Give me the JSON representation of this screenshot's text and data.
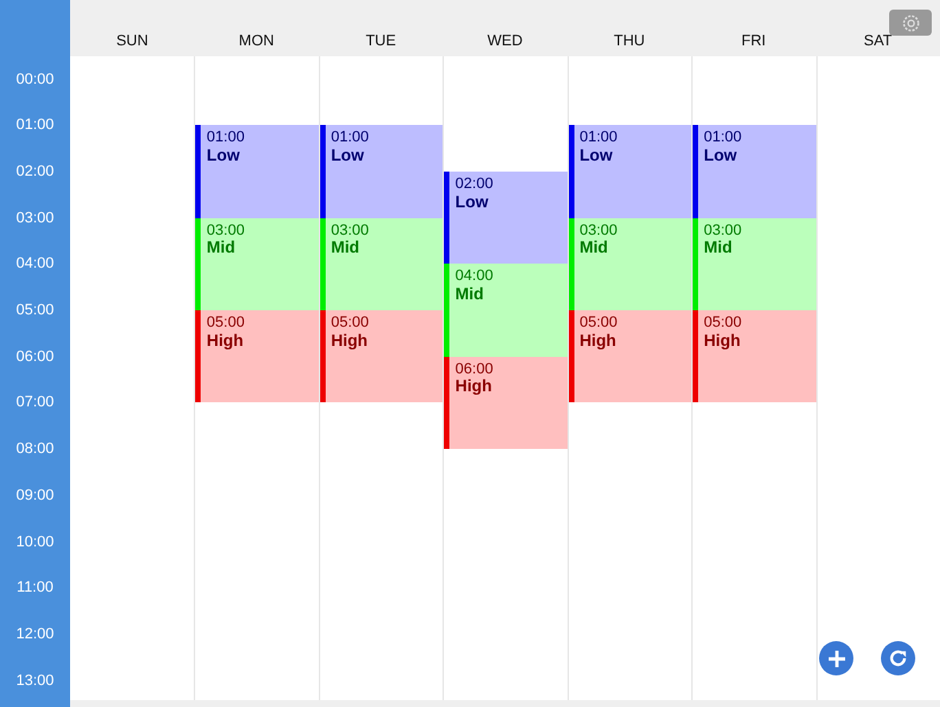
{
  "hours": [
    "00:00",
    "01:00",
    "02:00",
    "03:00",
    "04:00",
    "05:00",
    "06:00",
    "07:00",
    "08:00",
    "09:00",
    "10:00",
    "11:00",
    "12:00",
    "13:00"
  ],
  "days": [
    {
      "label": "SUN"
    },
    {
      "label": "MON",
      "events": [
        {
          "time": "01:00",
          "label": "Low",
          "kind": "low",
          "color": "#0000ee"
        },
        {
          "time": "03:00",
          "label": "Mid",
          "kind": "mid",
          "color": "#00ee00"
        },
        {
          "time": "05:00",
          "label": "High",
          "kind": "high",
          "color": "#ee0000"
        }
      ]
    },
    {
      "label": "TUE",
      "events": [
        {
          "time": "01:00",
          "label": "Low",
          "kind": "low",
          "color": "#0000ee"
        },
        {
          "time": "03:00",
          "label": "Mid",
          "kind": "mid",
          "color": "#00ee00"
        },
        {
          "time": "05:00",
          "label": "High",
          "kind": "high",
          "color": "#ee0000"
        }
      ]
    },
    {
      "label": "WED",
      "events": [
        {
          "time": "02:00",
          "label": "Low",
          "kind": "low",
          "color": "#0000ee"
        },
        {
          "time": "04:00",
          "label": "Mid",
          "kind": "mid",
          "color": "#00ee00"
        },
        {
          "time": "06:00",
          "label": "High",
          "kind": "high",
          "color": "#ee0000"
        }
      ]
    },
    {
      "label": "THU",
      "events": [
        {
          "time": "01:00",
          "label": "Low",
          "kind": "low",
          "color": "#0000ee"
        },
        {
          "time": "03:00",
          "label": "Mid",
          "kind": "mid",
          "color": "#00ee00"
        },
        {
          "time": "05:00",
          "label": "High",
          "kind": "high",
          "color": "#ee0000"
        }
      ]
    },
    {
      "label": "FRI",
      "events": [
        {
          "time": "01:00",
          "label": "Low",
          "kind": "low",
          "color": "#0000ee"
        },
        {
          "time": "03:00",
          "label": "Mid",
          "kind": "mid",
          "color": "#00ee00"
        },
        {
          "time": "05:00",
          "label": "High",
          "kind": "high",
          "color": "#ee0000"
        }
      ]
    },
    {
      "label": "SAT"
    }
  ]
}
